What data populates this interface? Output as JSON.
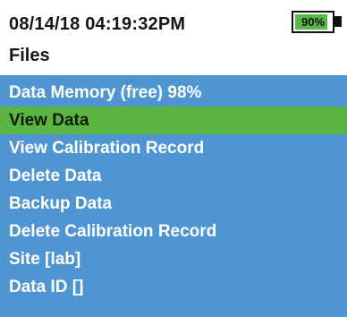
{
  "status_bar": {
    "datetime": "08/14/18  04:19:32PM",
    "battery_percent": 0.9,
    "battery_label": "90%",
    "battery_fill_color": "#57b847"
  },
  "screen_title": "Files",
  "menu": {
    "background_color": "#4f95d2",
    "selected_color": "#5bb543",
    "items": [
      {
        "label": "Data Memory (free) 98%",
        "selected": false
      },
      {
        "label": "View Data",
        "selected": true
      },
      {
        "label": "View Calibration Record",
        "selected": false
      },
      {
        "label": "Delete Data",
        "selected": false
      },
      {
        "label": "Backup Data",
        "selected": false
      },
      {
        "label": "Delete Calibration Record",
        "selected": false
      },
      {
        "label": "Site [lab]",
        "selected": false
      },
      {
        "label": "Data ID []",
        "selected": false
      }
    ]
  }
}
